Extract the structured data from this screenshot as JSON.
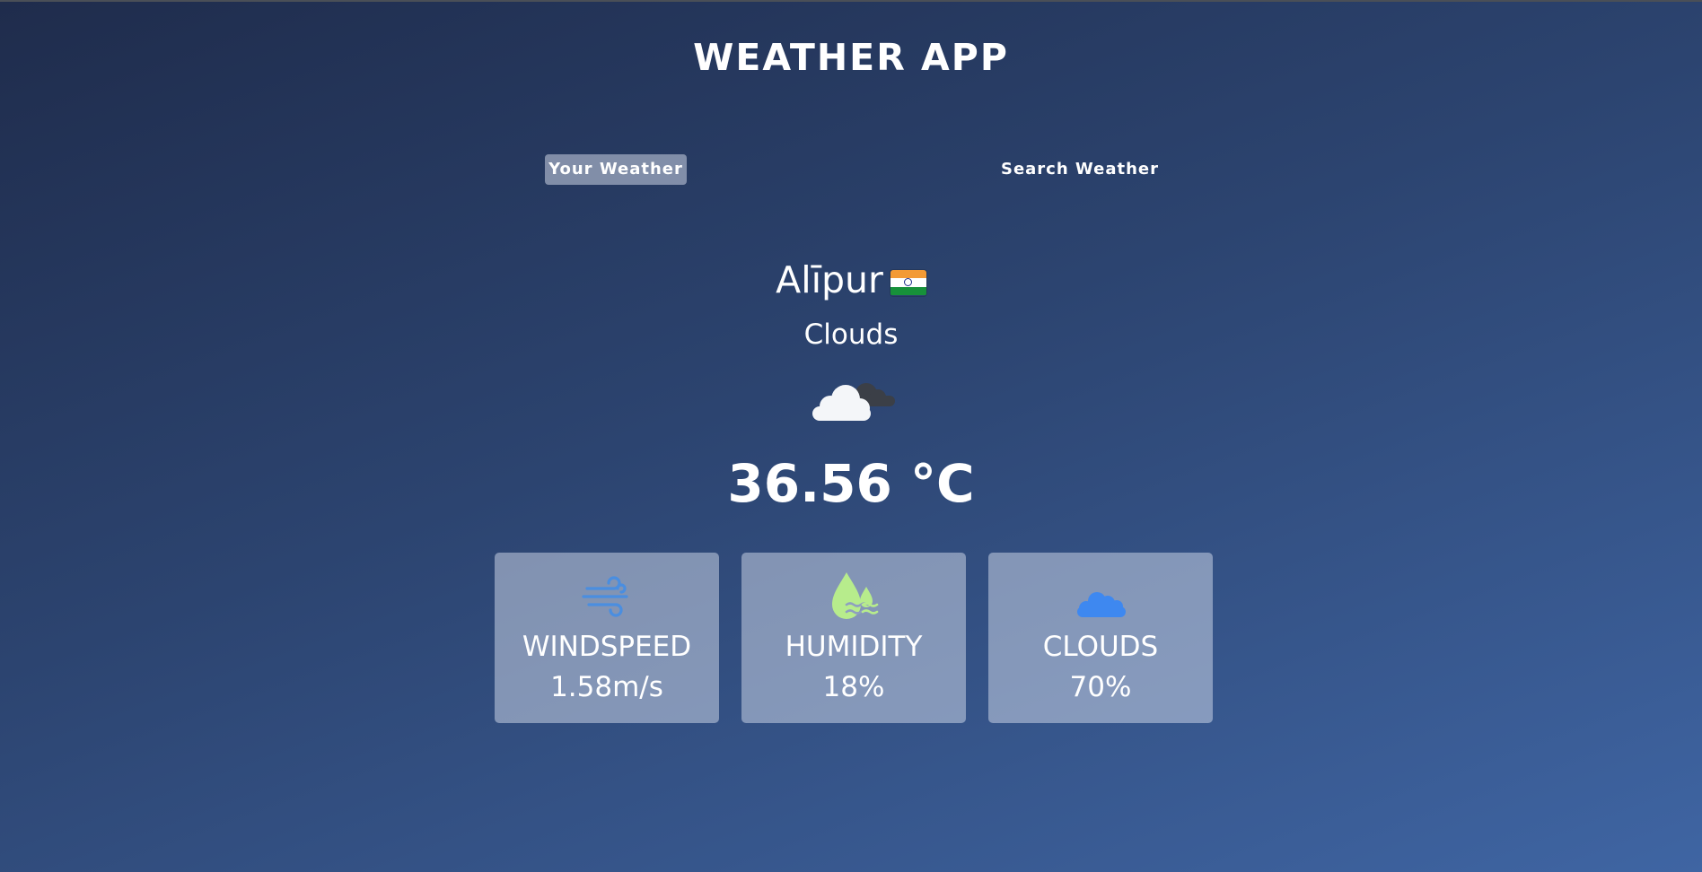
{
  "app": {
    "title": "WEATHER APP"
  },
  "tabs": [
    {
      "label": "Your Weather",
      "active": true
    },
    {
      "label": "Search Weather",
      "active": false
    }
  ],
  "weather": {
    "city": "Alīpur",
    "country_flag": "india-flag-icon",
    "condition": "Clouds",
    "condition_icon": "cloud-icon",
    "temperature": "36.56 °C"
  },
  "cards": [
    {
      "label": "WINDSPEED",
      "value": "1.58m/s",
      "icon": "wind-icon",
      "icon_color": "#4a8ee0"
    },
    {
      "label": "HUMIDITY",
      "value": "18%",
      "icon": "humidity-icon",
      "icon_color": "#b7ec8c"
    },
    {
      "label": "CLOUDS",
      "value": "70%",
      "icon": "cloud-icon",
      "icon_color": "#3e88f0"
    }
  ],
  "colors": {
    "background_top": "#1f2c4c",
    "background_bottom": "#3f65a3",
    "card": "#8e9fc0",
    "text": "#ffffff"
  }
}
